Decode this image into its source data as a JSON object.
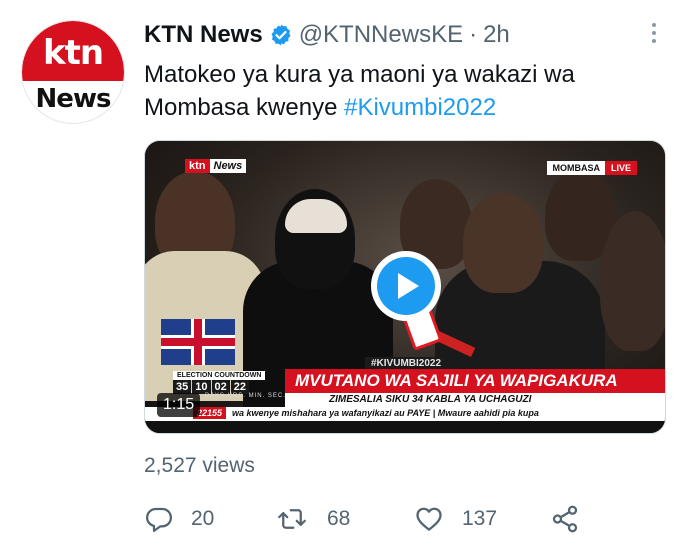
{
  "avatar": {
    "logo_top": "ktn",
    "logo_bottom": "News"
  },
  "tweet": {
    "name": "KTN News",
    "handle": "@KTNNewsKE",
    "separator": "·",
    "time": "2h",
    "text_main": "Matokeo ya kura ya maoni ya wakazi wa Mombasa kwenye ",
    "hashtag": "#Kivumbi2022"
  },
  "video": {
    "channel_logo_left": "ktn",
    "channel_logo_right": "News",
    "location": "MOMBASA",
    "live": "LIVE",
    "hashtag_bar": "#KIVUMBI2022",
    "countdown_label": "ELECTION COUNTDOWN",
    "countdown": [
      "35",
      "10",
      "02",
      "22"
    ],
    "countdown_units": "DAYS HRS. MIN. SEC.",
    "headline": "MVUTANO WA SAJILI YA WAPIGAKURA",
    "subline": "ZIMESALIA SIKU 34 KABLA YA UCHAGUZI",
    "ticker_number": "22155",
    "ticker_text": "wa kwenye mishahara ya wafanyikazi au PAYE  |  Mwaure aahidi pia kupa",
    "timestamp": "1:15"
  },
  "stats": {
    "views": "2,527 views"
  },
  "actions": {
    "replies": "20",
    "retweets": "68",
    "likes": "137"
  },
  "colors": {
    "accent": "#1d9bf0",
    "muted": "#536471",
    "ktn_red": "#d6111f"
  },
  "icons": [
    "verified-badge-icon",
    "more-options-icon",
    "play-icon",
    "reply-icon",
    "retweet-icon",
    "like-icon",
    "share-icon"
  ]
}
